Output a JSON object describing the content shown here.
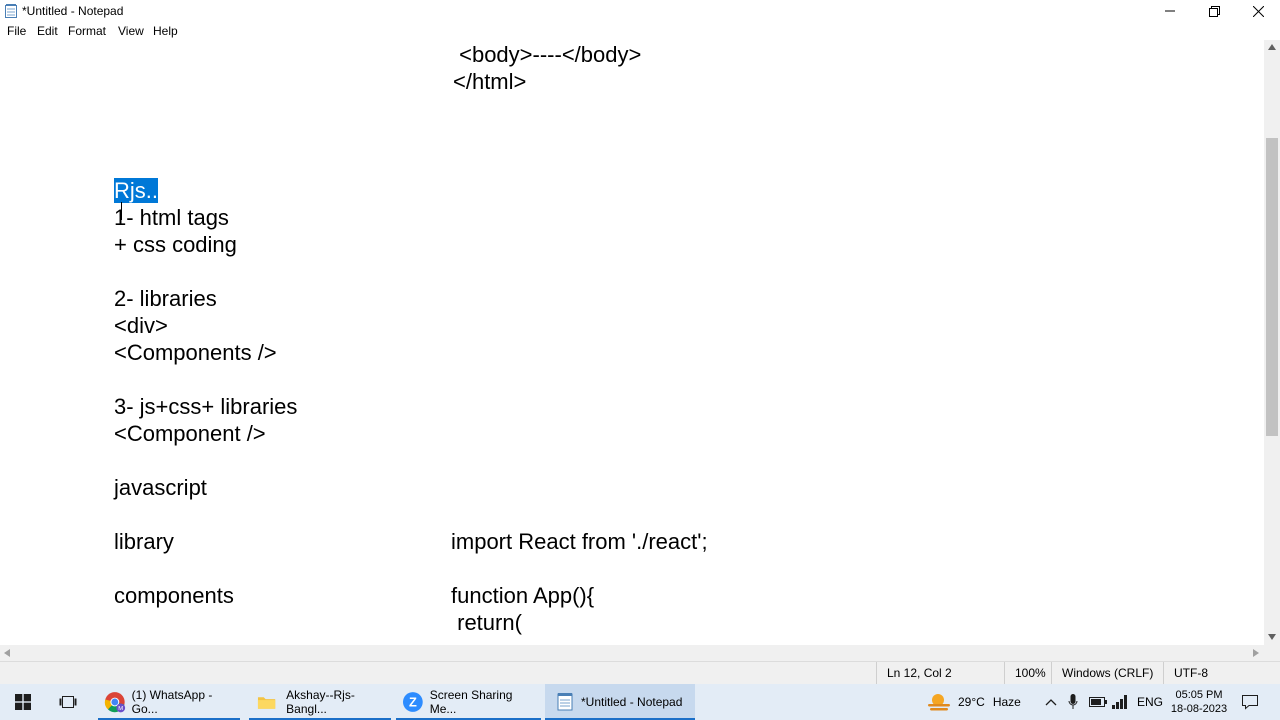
{
  "window": {
    "title": "*Untitled - Notepad"
  },
  "menu": [
    "File",
    "Edit",
    "Format",
    "View",
    "Help"
  ],
  "editor": {
    "lines": [
      {
        "text": " <body>----</body>"
      },
      {
        "text": "</html>"
      },
      {
        "text": "Rjs..",
        "selected": true
      },
      {
        "text": "1- html tags"
      },
      {
        "text": "+ css coding"
      },
      {
        "text": "2- libraries"
      },
      {
        "text": "<div>"
      },
      {
        "text": "<Components />"
      },
      {
        "text": "3- js+css+ libraries"
      },
      {
        "text": "<Component />"
      },
      {
        "text": "javascript"
      },
      {
        "text": "library"
      },
      {
        "text": "import React from './react';"
      },
      {
        "text": "components"
      },
      {
        "text": "function App(){"
      },
      {
        "text": " return("
      }
    ]
  },
  "status": {
    "position": "Ln 12, Col 2",
    "zoom": "100%",
    "line_ending": "Windows (CRLF)",
    "encoding": "UTF-8"
  },
  "taskbar": {
    "items": [
      {
        "label": "(1) WhatsApp - Go..."
      },
      {
        "label": "Akshay--Rjs-Bangl..."
      },
      {
        "label": "Screen Sharing Me..."
      },
      {
        "label": "*Untitled - Notepad"
      }
    ],
    "weather": {
      "temp": "29°C",
      "condition": "Haze"
    },
    "language": "ENG",
    "time": "05:05 PM",
    "date": "18-08-2023"
  },
  "colors": {
    "selection": "#0078d7",
    "taskbar": "#e3ecf6",
    "accent": "#1b6fc8"
  }
}
